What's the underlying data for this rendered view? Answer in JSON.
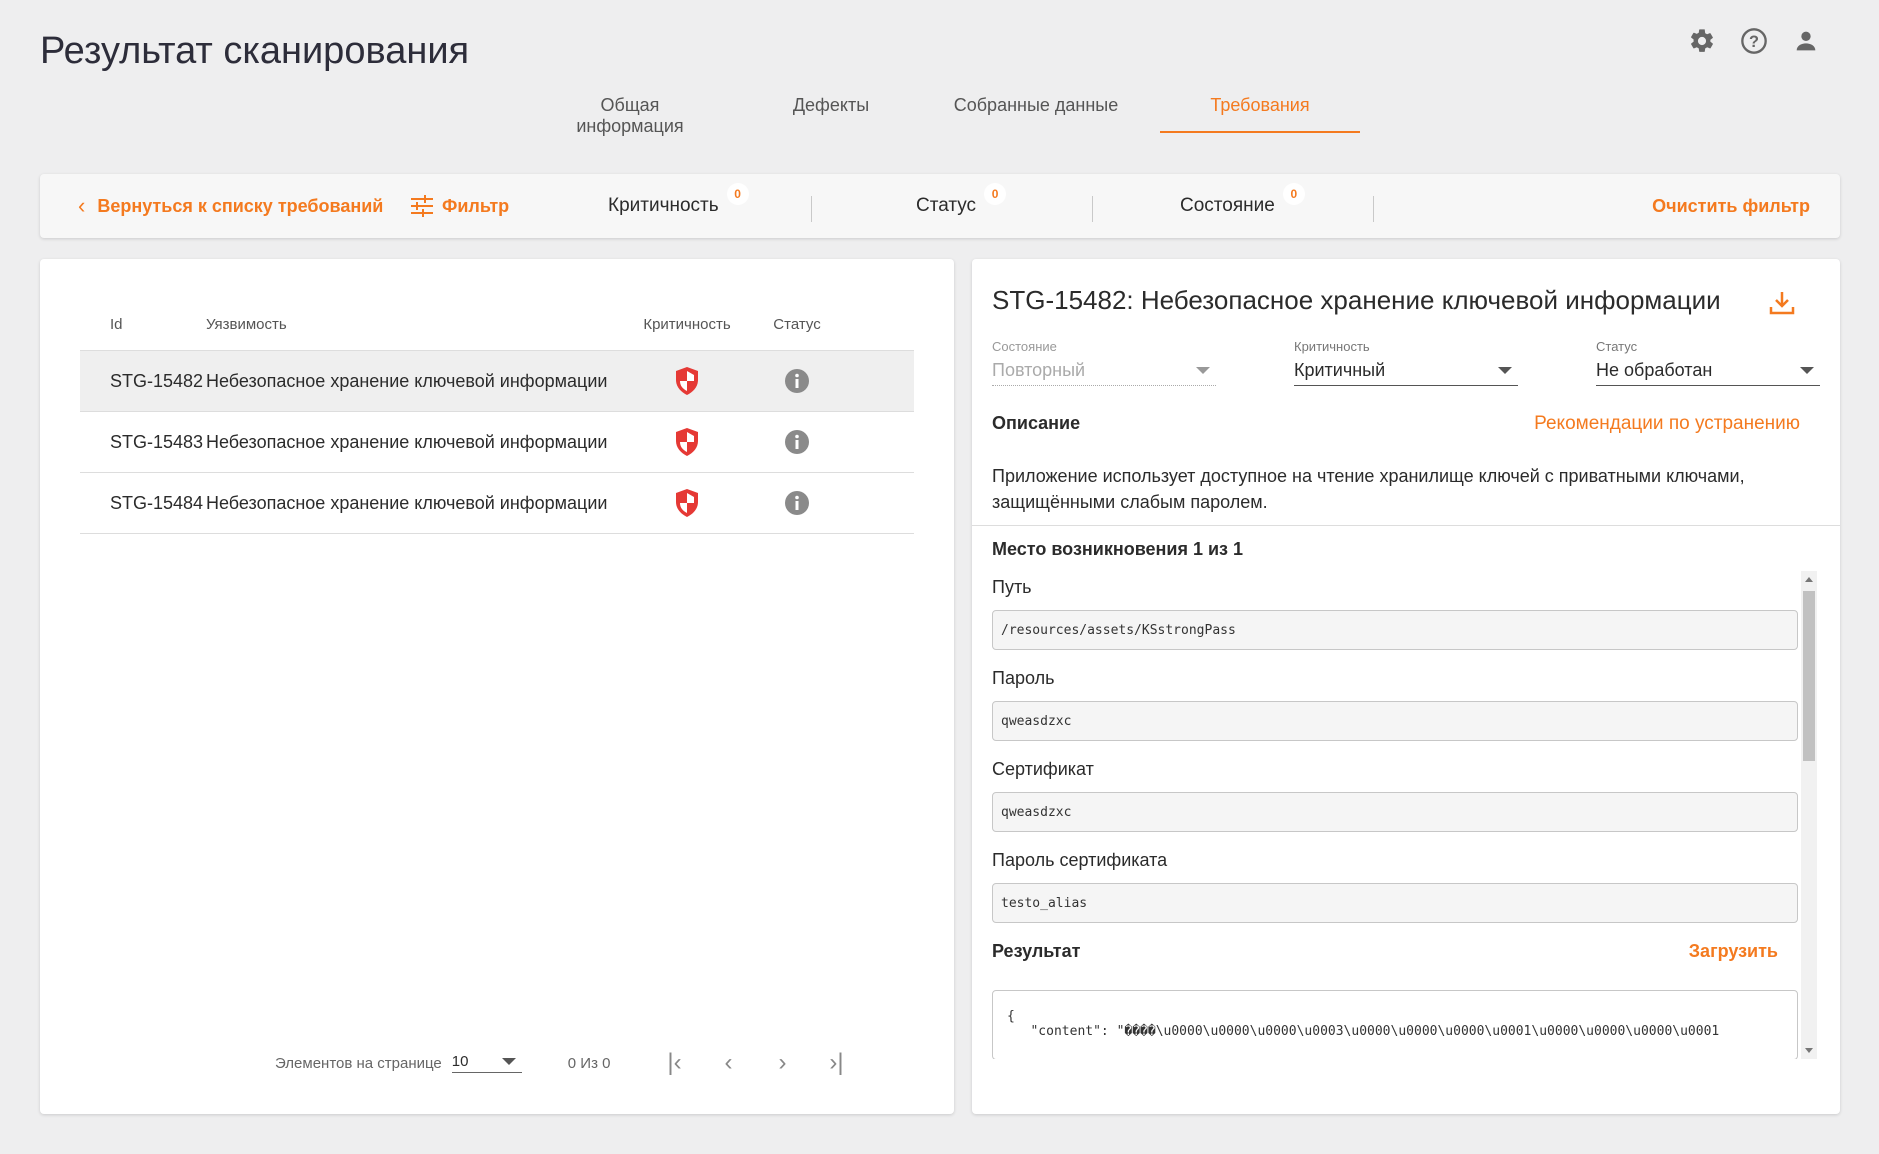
{
  "header": {
    "title": "Результат сканирования"
  },
  "top_icons": [
    "gear-icon",
    "help-icon",
    "user-icon"
  ],
  "tabs": [
    {
      "label": "Общая информация",
      "active": false
    },
    {
      "label": "Дефекты",
      "active": false
    },
    {
      "label": "Собранные данные",
      "active": false
    },
    {
      "label": "Требования",
      "active": true
    }
  ],
  "filter_bar": {
    "back_label": "Вернуться к списку требований",
    "filter_label": "Фильтр",
    "criticality": {
      "label": "Критичность",
      "count": "0"
    },
    "status": {
      "label": "Статус",
      "count": "0"
    },
    "state": {
      "label": "Состояние",
      "count": "0"
    },
    "clear_label": "Очистить фильтр"
  },
  "table": {
    "columns": [
      "Id",
      "Уязвимость",
      "Критичность",
      "Статус"
    ],
    "rows": [
      {
        "id": "STG-15482",
        "vulnerability": "Небезопасное хранение ключевой информации",
        "criticality_icon": "shield-icon",
        "status_icon": "info-icon",
        "selected": true
      },
      {
        "id": "STG-15483",
        "vulnerability": "Небезопасное хранение ключевой информации",
        "criticality_icon": "shield-icon",
        "status_icon": "info-icon",
        "selected": false
      },
      {
        "id": "STG-15484",
        "vulnerability": "Небезопасное хранение ключевой информации",
        "criticality_icon": "shield-icon",
        "status_icon": "info-icon",
        "selected": false
      }
    ]
  },
  "pagination": {
    "per_page_label": "Элементов на странице",
    "per_page_value": "10",
    "range_text": "0 Из 0"
  },
  "detail": {
    "title": "STG-15482: Небезопасное хранение ключевой информации",
    "state": {
      "label": "Состояние",
      "value": "Повторный"
    },
    "criticality": {
      "label": "Критичность",
      "value": "Критичный"
    },
    "status": {
      "label": "Статус",
      "value": "Не обработан"
    },
    "description_header": "Описание",
    "recommendations_link": "Рекомендации по устранению",
    "description_text": "Приложение использует доступное на чтение хранилище ключей с приватными ключами, защищёнными слабым паролем.",
    "location_header": "Место возникновения 1 из 1",
    "fields": [
      {
        "label": "Путь",
        "value": "/resources/assets/KSstrongPass"
      },
      {
        "label": "Пароль",
        "value": "qweasdzxc"
      },
      {
        "label": "Сертификат",
        "value": "qweasdzxc"
      },
      {
        "label": "Пароль сертификата",
        "value": "testo_alias"
      }
    ],
    "result_header": "Результат",
    "result_load": "Загрузить",
    "result_text": "{\n   \"content\": \"����\\u0000\\u0000\\u0000\\u0003\\u0000\\u0000\\u0000\\u0001\\u0000\\u0000\\u0000\\u0001"
  },
  "colors": {
    "accent": "#f47a1f",
    "critical": "#e53935",
    "status_grey": "#8a8a8a"
  }
}
